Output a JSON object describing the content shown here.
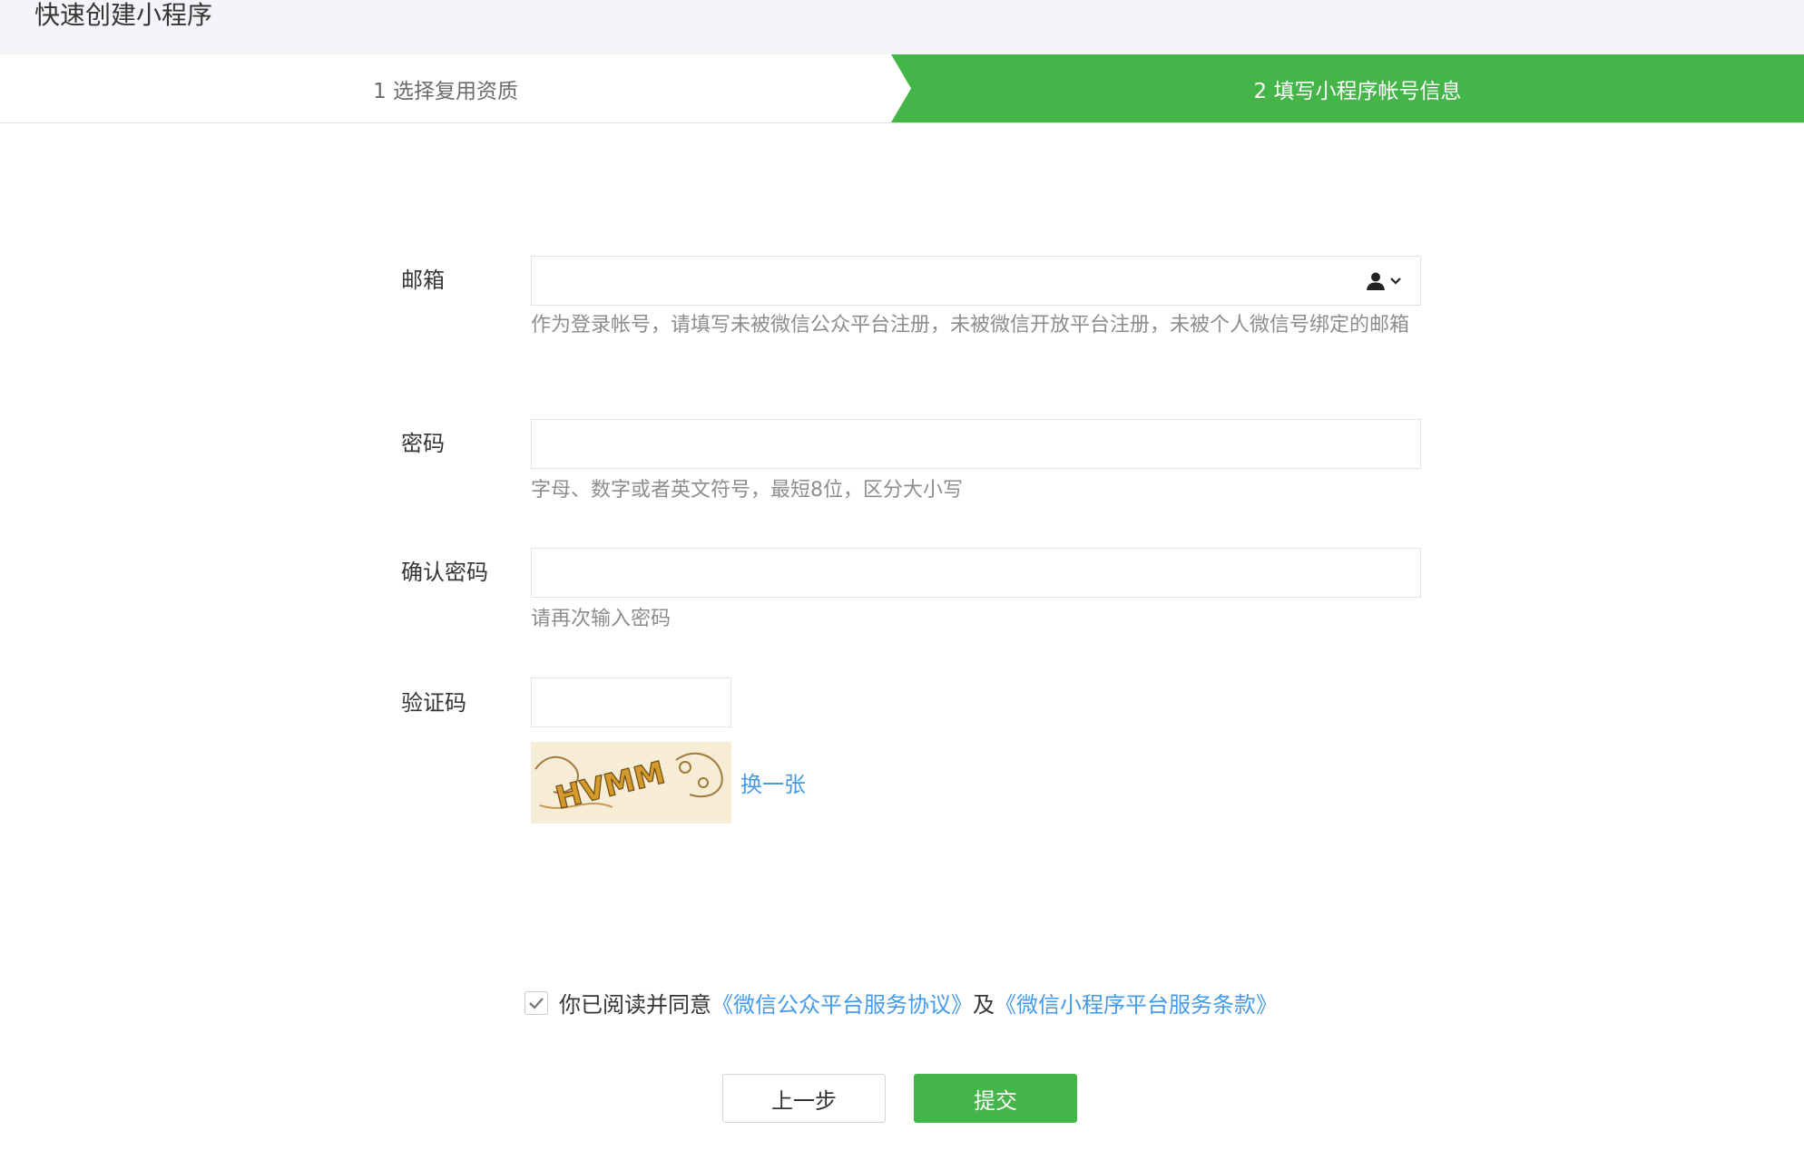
{
  "header": {
    "title": "快速创建小程序"
  },
  "steps": [
    {
      "label": "1 选择复用资质"
    },
    {
      "label": "2 填写小程序帐号信息"
    }
  ],
  "form": {
    "email": {
      "label": "邮箱",
      "value": "",
      "hint": "作为登录帐号，请填写未被微信公众平台注册，未被微信开放平台注册，未被个人微信号绑定的邮箱"
    },
    "password": {
      "label": "密码",
      "value": "",
      "hint": "字母、数字或者英文符号，最短8位，区分大小写"
    },
    "confirm": {
      "label": "确认密码",
      "value": "",
      "hint": "请再次输入密码"
    },
    "captcha": {
      "label": "验证码",
      "value": "",
      "image_text": "HVMM",
      "refresh": "换一张"
    }
  },
  "agreement": {
    "checked": true,
    "text": "你已阅读并同意",
    "link1": "《微信公众平台服务协议》",
    "and": "及",
    "link2": "《微信小程序平台服务条款》"
  },
  "buttons": {
    "prev": "上一步",
    "submit": "提交"
  },
  "colors": {
    "accent": "#44b549",
    "link": "#459ae9",
    "hint": "#8d8d8d"
  },
  "icons": {
    "account": "user-dropdown-icon",
    "check": "check-icon"
  }
}
